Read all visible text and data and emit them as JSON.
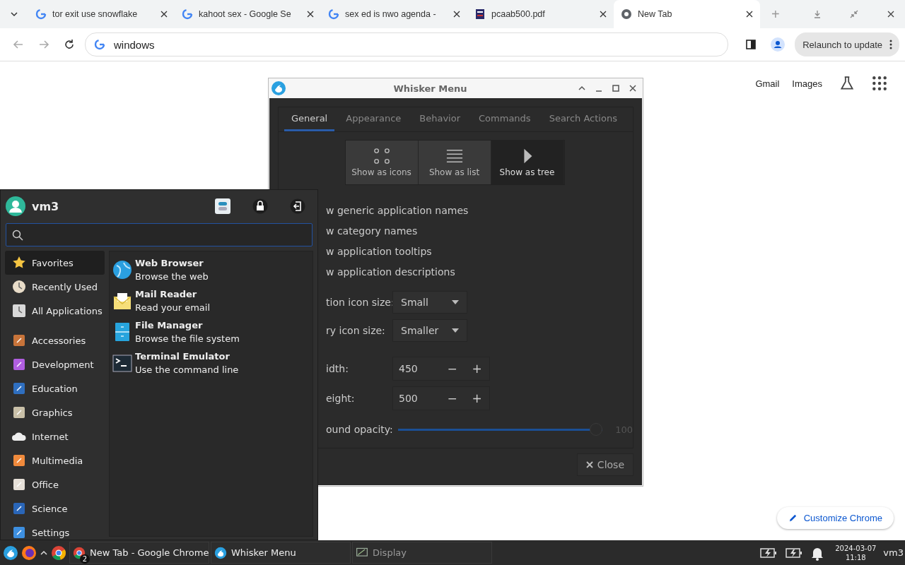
{
  "browser": {
    "tabs": [
      {
        "title": "tor exit use snowflake",
        "kind": "google",
        "selected": false
      },
      {
        "title": "kahoot sex - Google Se",
        "kind": "google",
        "selected": false
      },
      {
        "title": "sex ed is nwo agenda -",
        "kind": "google",
        "selected": false
      },
      {
        "title": "pcaab500.pdf",
        "kind": "pdf",
        "selected": false
      },
      {
        "title": "New Tab",
        "kind": "chrome",
        "selected": true
      }
    ],
    "new_tab": "+",
    "address": "windows",
    "relaunch": "Relaunch to update",
    "links": [
      "Gmail",
      "Images"
    ],
    "customize": "Customize Chrome"
  },
  "settings_window": {
    "title": "Whisker Menu",
    "tabs": [
      {
        "label": "General",
        "selected": true
      },
      {
        "label": "Appearance",
        "selected": false
      },
      {
        "label": "Behavior",
        "selected": false
      },
      {
        "label": "Commands",
        "selected": false
      },
      {
        "label": "Search Actions",
        "selected": false
      }
    ],
    "view_modes": [
      {
        "label": "Show as icons",
        "kind": "icons",
        "selected": false
      },
      {
        "label": "Show as list",
        "kind": "list",
        "selected": false
      },
      {
        "label": "Show as tree",
        "kind": "tree",
        "selected": true
      }
    ],
    "options": [
      "w generic application names",
      "w category names",
      "w application tooltips",
      "w application descriptions"
    ],
    "dropdowns": [
      {
        "label": "tion icon size:",
        "value": "Small"
      },
      {
        "label": "ry icon size:",
        "value": "Smaller"
      }
    ],
    "spinners": [
      {
        "label": "idth:",
        "value": "450",
        "minus": "−",
        "plus": "+"
      },
      {
        "label": "eight:",
        "value": "500",
        "minus": "−",
        "plus": "+"
      }
    ],
    "opacity": {
      "label": "ound opacity:",
      "level": 1,
      "reading": "100"
    },
    "close": "Close"
  },
  "menu": {
    "user": "vm3",
    "pinned": [
      {
        "label": "Favorites",
        "kind": "favorites",
        "selected": true
      },
      {
        "label": "Recently Used",
        "kind": "recent",
        "selected": false
      },
      {
        "label": "All Applications",
        "kind": "all",
        "selected": false
      }
    ],
    "categories": [
      {
        "label": "Accessories",
        "kind": "accessories",
        "selected": false
      },
      {
        "label": "Development",
        "kind": "development",
        "selected": false
      },
      {
        "label": "Education",
        "kind": "education",
        "selected": false
      },
      {
        "label": "Graphics",
        "kind": "graphics",
        "selected": false
      },
      {
        "label": "Internet",
        "kind": "internet",
        "selected": false
      },
      {
        "label": "Multimedia",
        "kind": "multimedia",
        "selected": false
      },
      {
        "label": "Office",
        "kind": "office",
        "selected": false
      },
      {
        "label": "Science",
        "kind": "science",
        "selected": false
      },
      {
        "label": "Settings",
        "kind": "settings",
        "selected": false
      }
    ],
    "apps": [
      {
        "name": "Web Browser",
        "description": "Browse the web",
        "kind": "browser"
      },
      {
        "name": "Mail Reader",
        "description": "Read your email",
        "kind": "mail"
      },
      {
        "name": "File Manager",
        "description": "Browse the file system",
        "kind": "files"
      },
      {
        "name": "Terminal Emulator",
        "description": "Use the command line",
        "kind": "terminal"
      }
    ]
  },
  "taskbar": {
    "windows": [
      {
        "label": "New Tab - Google Chrome",
        "kind": "chrome",
        "badge": "2",
        "minimized": false
      },
      {
        "label": "Whisker Menu",
        "kind": "whisker",
        "minimized": false
      },
      {
        "label": "Display",
        "kind": "display",
        "minimized": true
      }
    ],
    "date": "2024-03-07",
    "time": "11:18",
    "user": "vm3"
  }
}
